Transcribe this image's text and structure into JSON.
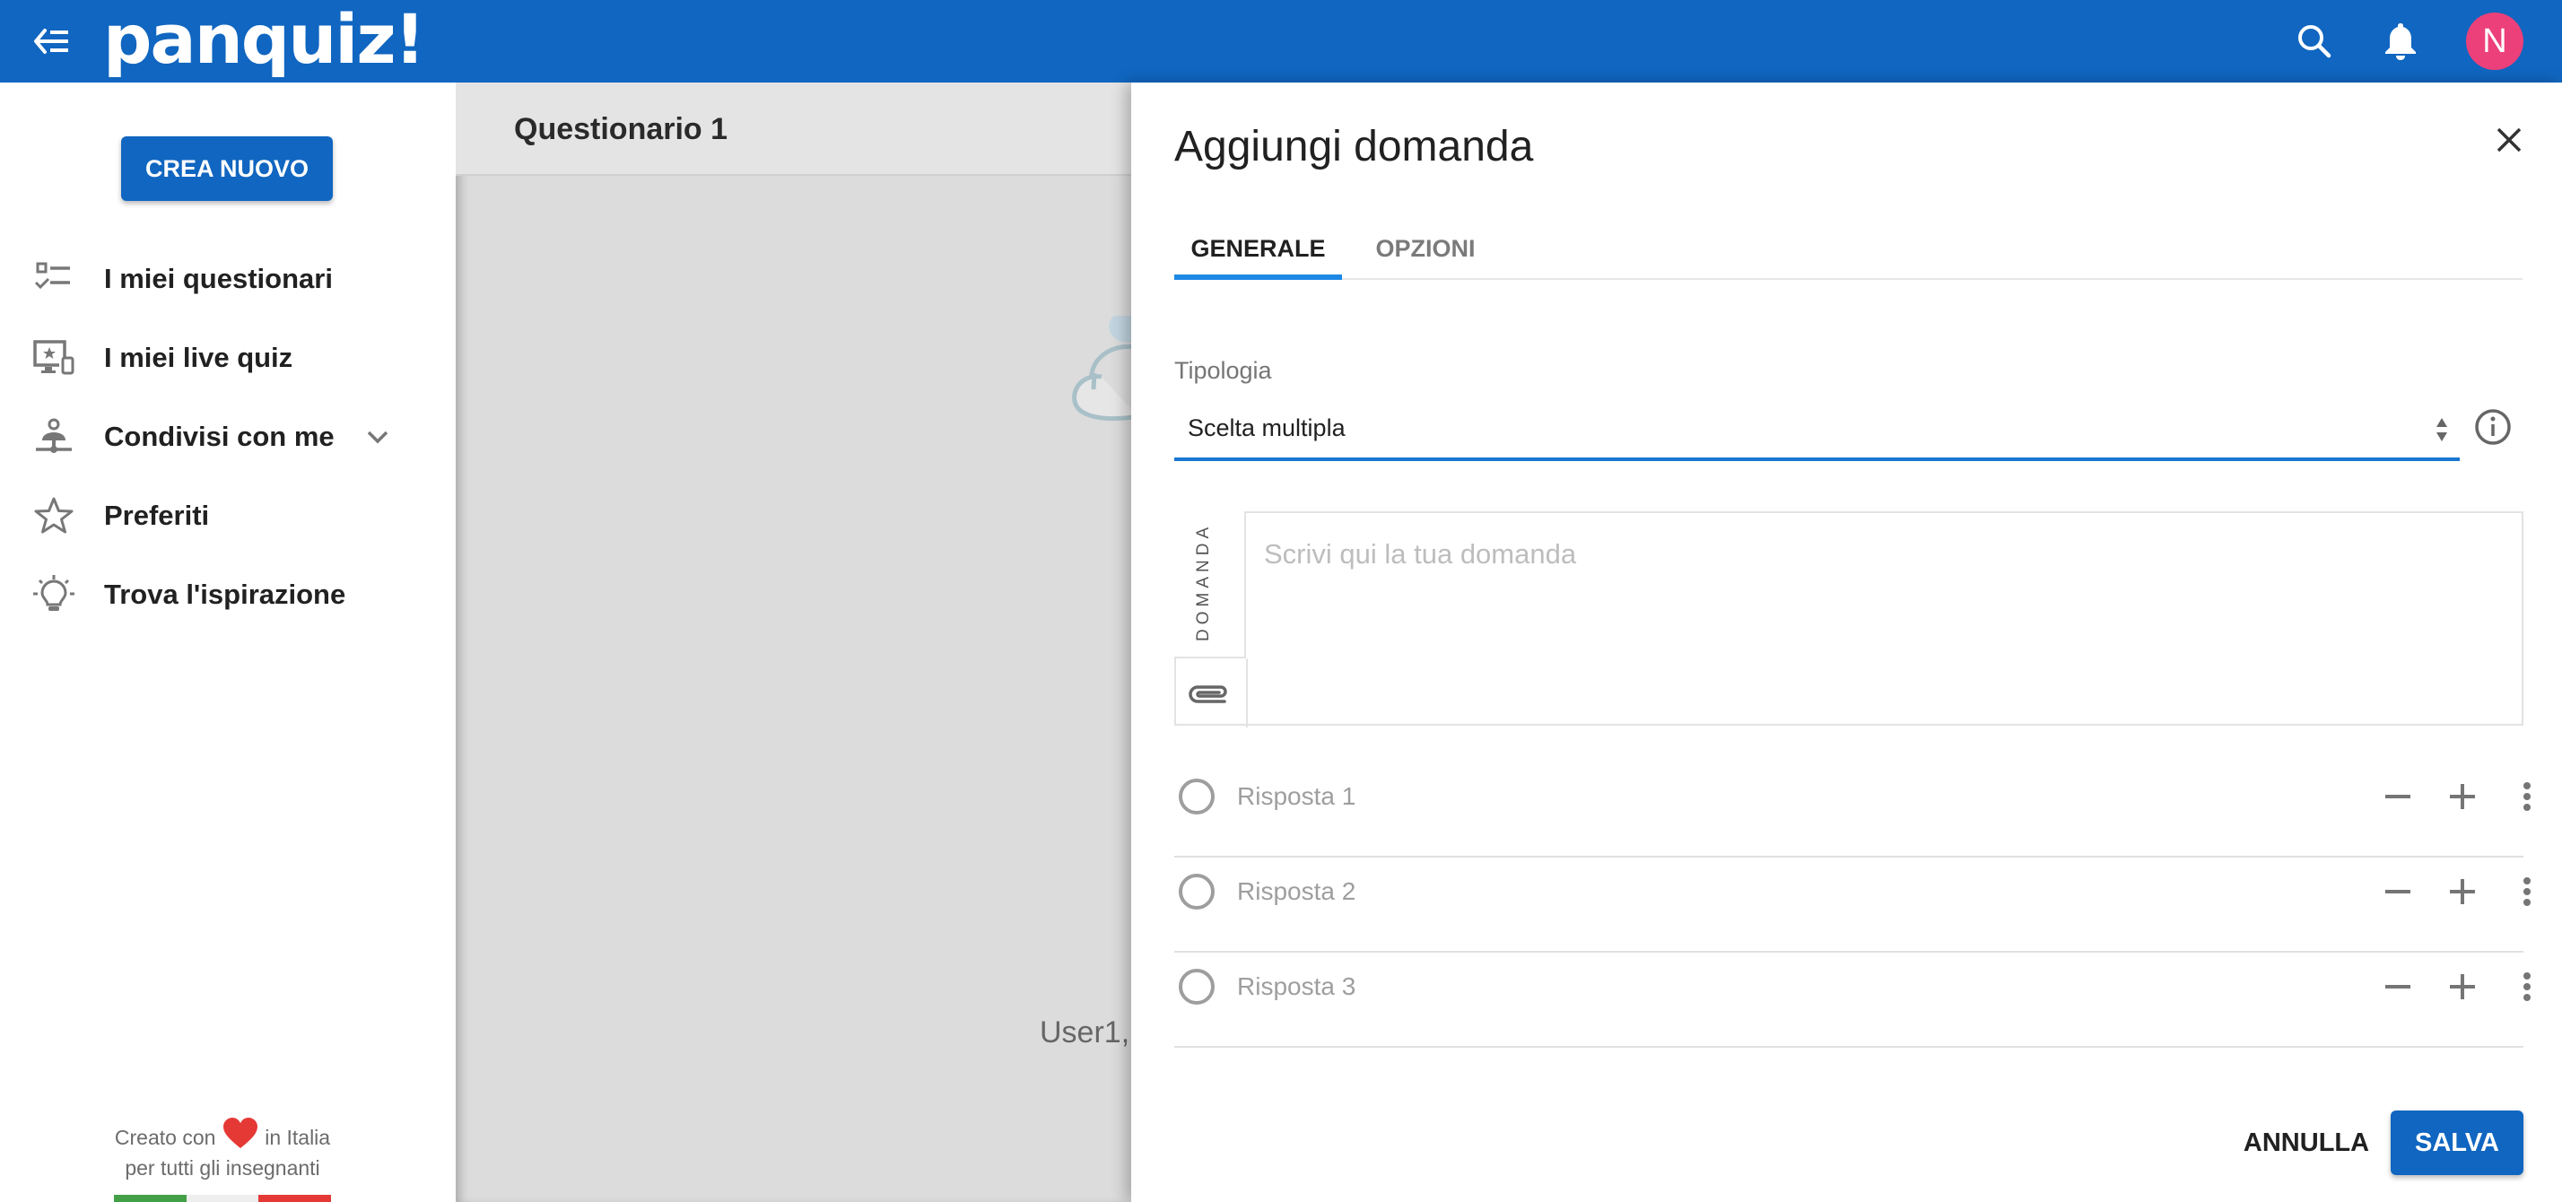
{
  "header": {
    "logo": "panquiz!",
    "menu_icon": "menu-collapse-icon",
    "search_icon": "search-icon",
    "bell_icon": "bell-icon",
    "avatar_initial": "N",
    "brand_color": "#1066C0",
    "avatar_color": "#EC407A"
  },
  "sidebar": {
    "create_button": "CREA NUOVO",
    "items": [
      {
        "label": "I miei questionari",
        "icon": "checklist-icon"
      },
      {
        "label": "I miei live quiz",
        "icon": "devices-star-icon"
      },
      {
        "label": "Condivisi con me",
        "icon": "shared-person-icon",
        "expandable": true
      },
      {
        "label": "Preferiti",
        "icon": "star-icon"
      },
      {
        "label": "Trova l'ispirazione",
        "icon": "lightbulb-icon"
      }
    ],
    "footer": {
      "line1_before": "Creato con",
      "line1_after": "in Italia",
      "line2": "per tutti gli insegnanti",
      "flag_colors": [
        "#43A047",
        "#EEEEEE",
        "#E53935"
      ]
    }
  },
  "main": {
    "title": "Questionario 1",
    "partial_text": "User1,"
  },
  "drawer": {
    "title": "Aggiungi domanda",
    "tabs": [
      {
        "label": "GENERALE",
        "active": true
      },
      {
        "label": "OPZIONI",
        "active": false
      }
    ],
    "type_label": "Tipologia",
    "type_value": "Scelta multipla",
    "question_side_label": "DOMANDA",
    "question_placeholder": "Scrivi qui la tua domanda",
    "question_value": "",
    "answers": [
      {
        "placeholder": "Risposta 1",
        "value": "",
        "correct": false
      },
      {
        "placeholder": "Risposta 2",
        "value": "",
        "correct": false
      },
      {
        "placeholder": "Risposta 3",
        "value": "",
        "correct": false
      }
    ],
    "cancel_label": "ANNULLA",
    "save_label": "SALVA",
    "accent_color": "#1E88E5"
  }
}
